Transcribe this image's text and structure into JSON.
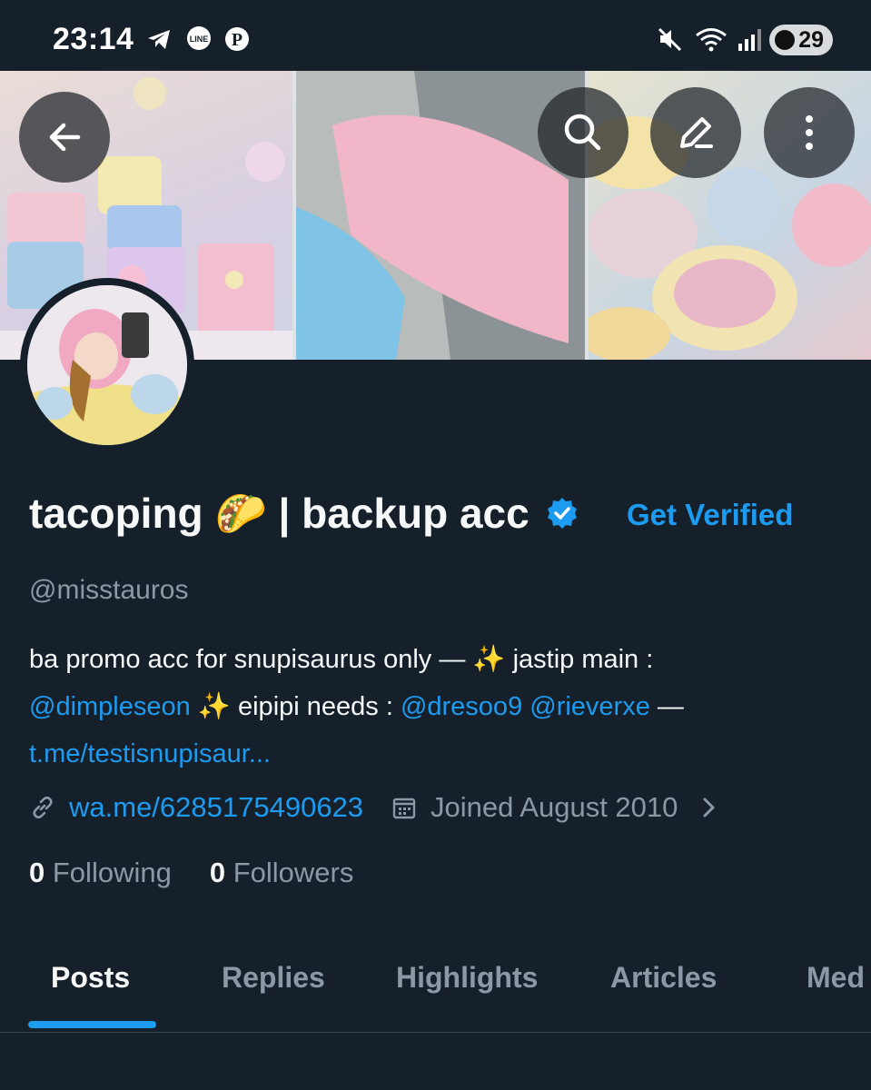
{
  "status_bar": {
    "time": "23:14",
    "battery": "29",
    "icons": [
      "telegram-icon",
      "line-icon",
      "pinterest-icon",
      "mute-icon",
      "wifi-icon",
      "signal-icon"
    ]
  },
  "colors": {
    "background": "#15202b",
    "accent": "#1d9bf0",
    "secondary_text": "#8b98a5"
  },
  "profile": {
    "name": "tacoping 🌮 | backup acc",
    "get_verified": "Get Verified",
    "handle": "@misstauros",
    "bio": {
      "part1": "ba promo acc for snupisaurus only — ✨ jastip main :",
      "mention1": "@dimpleseon",
      "part2": " ✨ eipipi needs : ",
      "mention2": "@dresoo9",
      "mention3": "@rieverxe",
      "part3": "  —",
      "link": "t.me/testisnupisaur..."
    },
    "website": "wa.me/6285175490623",
    "joined": "Joined August 2010",
    "following_count": "0",
    "following_label": "Following",
    "followers_count": "0",
    "followers_label": "Followers"
  },
  "tabs": [
    {
      "label": "Posts"
    },
    {
      "label": "Replies"
    },
    {
      "label": "Highlights"
    },
    {
      "label": "Articles"
    },
    {
      "label": "Med"
    }
  ]
}
